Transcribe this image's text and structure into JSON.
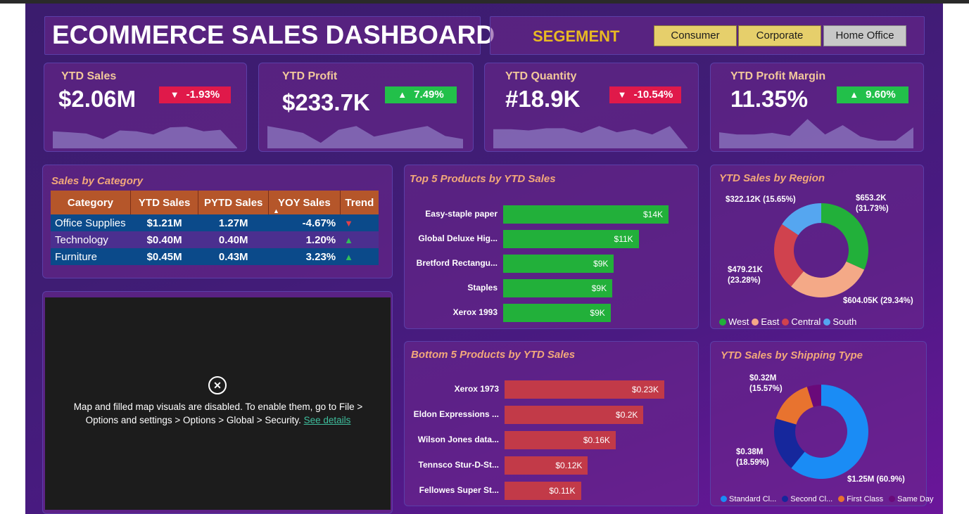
{
  "header": {
    "title": "ECOMMERCE SALES DASHBOARD",
    "segment_label": "SEGEMENT",
    "segments": [
      "Consumer",
      "Corporate",
      "Home Office"
    ]
  },
  "kpis": [
    {
      "title": "YTD Sales",
      "value": "$2.06M",
      "change": "-1.93%",
      "direction": "down"
    },
    {
      "title": "YTD Profit",
      "value": "$233.7K",
      "change": "7.49%",
      "direction": "up"
    },
    {
      "title": "YTD Quantity",
      "value": "#18.9K",
      "change": "-10.54%",
      "direction": "down"
    },
    {
      "title": "YTD Profit Margin",
      "value": "11.35%",
      "change": "9.60%",
      "direction": "up"
    }
  ],
  "category": {
    "title": "Sales by Category",
    "headers": [
      "Category",
      "YTD Sales",
      "PYTD Sales",
      "YOY Sales",
      "Trend"
    ],
    "rows": [
      {
        "category": "Office Supplies",
        "ytd": "$1.21M",
        "pytd": "1.27M",
        "yoy": "-4.67%",
        "trend": "down"
      },
      {
        "category": "Technology",
        "ytd": "$0.40M",
        "pytd": "0.40M",
        "yoy": "1.20%",
        "trend": "up"
      },
      {
        "category": "Furniture",
        "ytd": "$0.45M",
        "pytd": "0.43M",
        "yoy": "3.23%",
        "trend": "up"
      }
    ]
  },
  "map": {
    "message": "Map and filled map visuals are disabled. To enable them, go to File > Options and settings > Options > Global > Security.",
    "link": "See details"
  },
  "top5": {
    "title": "Top 5 Products by YTD Sales",
    "color": "#22b03a"
  },
  "bottom5": {
    "title": "Bottom 5 Products by YTD Sales",
    "color": "#c23a48"
  },
  "region": {
    "title": "YTD Sales by Region",
    "labels": {
      "west": [
        "$653.2K",
        "(31.73%)"
      ],
      "east": [
        "$604.05K (29.34%)"
      ],
      "central": [
        "$479.21K",
        "(23.28%)"
      ],
      "south": [
        "$322.12K (15.65%)"
      ]
    }
  },
  "shipping": {
    "title": "YTD Sales by Shipping Type",
    "labels": {
      "standard": [
        "$1.25M (60.9%)"
      ],
      "second": [
        "$0.38M",
        "(18.59%)"
      ],
      "first": [
        "$0.32M",
        "(15.57%)"
      ]
    }
  },
  "chart_data": [
    {
      "type": "bar",
      "title": "Top 5 Products by YTD Sales",
      "categories": [
        "Easy-staple paper",
        "Global Deluxe Hig...",
        "Bretford Rectangu...",
        "Staples",
        "Xerox 1993"
      ],
      "values": [
        14,
        11,
        9,
        9,
        9
      ],
      "value_labels": [
        "$14K",
        "$11K",
        "$9K",
        "$9K",
        "$9K"
      ],
      "bar_fractions": [
        1.0,
        0.82,
        0.67,
        0.66,
        0.65
      ]
    },
    {
      "type": "bar",
      "title": "Bottom 5 Products by YTD Sales",
      "categories": [
        "Xerox 1973",
        "Eldon Expressions ...",
        "Wilson Jones data...",
        "Tennsco Stur-D-St...",
        "Fellowes Super St..."
      ],
      "values": [
        0.23,
        0.2,
        0.16,
        0.12,
        0.11
      ],
      "value_labels": [
        "$0.23K",
        "$0.2K",
        "$0.16K",
        "$0.12K",
        "$0.11K"
      ]
    },
    {
      "type": "pie",
      "title": "YTD Sales by Region",
      "categories": [
        "West",
        "East",
        "Central",
        "South"
      ],
      "values": [
        653.2,
        604.05,
        479.21,
        322.12
      ],
      "percent": [
        31.73,
        29.34,
        23.28,
        15.65
      ],
      "colors": [
        "#22b03a",
        "#f4a987",
        "#d0424e",
        "#55a6f0"
      ],
      "legend": "bottom"
    },
    {
      "type": "pie",
      "title": "YTD Sales by Shipping Type",
      "categories": [
        "Standard Cl...",
        "Second Cl...",
        "First Class",
        "Same Day"
      ],
      "values": [
        1.25,
        0.38,
        0.32,
        0.1
      ],
      "percent": [
        60.9,
        18.59,
        15.57,
        4.94
      ],
      "colors": [
        "#1a8cf5",
        "#16279c",
        "#e8732f",
        "#6a0a7a"
      ],
      "legend": "bottom"
    },
    {
      "type": "area",
      "title": "YTD Sales",
      "values": [
        0.55,
        0.52,
        0.48,
        0.3,
        0.58,
        0.55,
        0.45,
        0.68,
        0.7,
        0.55,
        0.6,
        0.02
      ]
    },
    {
      "type": "area",
      "title": "YTD Profit",
      "values": [
        0.72,
        0.62,
        0.5,
        0.18,
        0.6,
        0.72,
        0.38,
        0.5,
        0.62,
        0.72,
        0.4,
        0.3
      ]
    },
    {
      "type": "area",
      "title": "YTD Quantity",
      "values": [
        0.62,
        0.62,
        0.58,
        0.65,
        0.65,
        0.5,
        0.72,
        0.52,
        0.62,
        0.45,
        0.72,
        0.02
      ]
    },
    {
      "type": "area",
      "title": "YTD Profit Margin",
      "values": [
        0.52,
        0.45,
        0.45,
        0.5,
        0.4,
        0.95,
        0.45,
        0.75,
        0.38,
        0.25,
        0.25,
        0.68
      ]
    }
  ]
}
